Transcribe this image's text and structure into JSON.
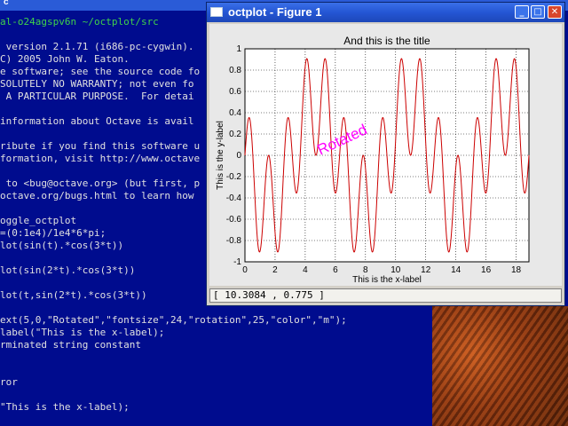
{
  "terminal": {
    "title": "c",
    "lines": [
      {
        "text": "al-o24agspv6n ~/octplot/src",
        "green": true
      },
      {
        "text": "",
        "green": false
      },
      {
        "text": " version 2.1.71 (i686-pc-cygwin).",
        "green": false
      },
      {
        "text": "C) 2005 John W. Eaton.",
        "green": false
      },
      {
        "text": "e software; see the source code fo",
        "green": false
      },
      {
        "text": "SOLUTELY NO WARRANTY; not even fo",
        "green": false
      },
      {
        "text": " A PARTICULAR PURPOSE.  For detai",
        "green": false
      },
      {
        "text": "",
        "green": false
      },
      {
        "text": "information about Octave is avail",
        "green": false
      },
      {
        "text": "",
        "green": false
      },
      {
        "text": "ribute if you find this software u",
        "green": false
      },
      {
        "text": "formation, visit http://www.octave",
        "green": false
      },
      {
        "text": "",
        "green": false
      },
      {
        "text": " to <bug@octave.org> (but first, p",
        "green": false
      },
      {
        "text": "octave.org/bugs.html to learn how",
        "green": false
      },
      {
        "text": "",
        "green": false
      },
      {
        "text": "oggle_octplot",
        "green": false
      },
      {
        "text": "=(0:1e4)/1e4*6*pi;",
        "green": false
      },
      {
        "text": "lot(sin(t).*cos(3*t))",
        "green": false
      },
      {
        "text": "",
        "green": false
      },
      {
        "text": "lot(sin(2*t).*cos(3*t))",
        "green": false
      },
      {
        "text": "",
        "green": false
      },
      {
        "text": "lot(t,sin(2*t).*cos(3*t))",
        "green": false
      },
      {
        "text": "",
        "green": false
      },
      {
        "text": "ext(5,0,\"Rotated\",\"fontsize\",24,\"rotation\",25,\"color\",\"m\");",
        "green": false
      },
      {
        "text": "label(\"This is the x-label);",
        "green": false
      },
      {
        "text": "rminated string constant",
        "green": false
      },
      {
        "text": "",
        "green": false
      },
      {
        "text": "",
        "green": false
      },
      {
        "text": "ror",
        "green": false
      },
      {
        "text": "",
        "green": false
      },
      {
        "text": "\"This is the x-label);",
        "green": false
      }
    ]
  },
  "figure": {
    "title": "octplot - Figure 1",
    "buttons": {
      "minimize": "_",
      "maximize": "□",
      "close": "✕"
    },
    "status": "[ 10.3084 , 0.775 ]"
  },
  "chart_data": {
    "type": "line",
    "title": "And this is the title",
    "xlabel": "This is the x-label",
    "ylabel": "This is the y-label",
    "xlim": [
      0,
      18.85
    ],
    "ylim": [
      -1,
      1
    ],
    "xticks": [
      0,
      2,
      4,
      6,
      8,
      10,
      12,
      14,
      16,
      18
    ],
    "yticks": [
      -1,
      -0.8,
      -0.6,
      -0.4,
      -0.2,
      0,
      0.2,
      0.4,
      0.6,
      0.8,
      1
    ],
    "series": [
      {
        "function": "sin(2*t).*cos(3*t)",
        "x_start": 0,
        "x_end": 18.85,
        "color": "#cc0000"
      }
    ],
    "annotation": {
      "text": "Rotated",
      "x": 5,
      "y": 0,
      "rotation": 25,
      "color": "#ff00ff"
    },
    "grid": true
  }
}
